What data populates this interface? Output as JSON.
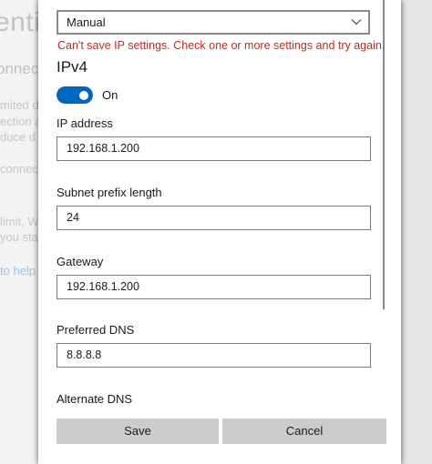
{
  "background": {
    "heading": "entit",
    "subheading": "onnect",
    "lines": [
      "mited da",
      "ection a",
      "duce d",
      "connect",
      "limit, W",
      "you stay"
    ],
    "link": "to help"
  },
  "dialog": {
    "assignment_select": {
      "value": "Manual"
    },
    "error_message": "Can't save IP settings. Check one or more settings and try again.",
    "section_title": "IPv4",
    "toggle": {
      "state": "on",
      "label": "On"
    },
    "fields": [
      {
        "label": "IP address",
        "value": "192.168.1.200"
      },
      {
        "label": "Subnet prefix length",
        "value": "24"
      },
      {
        "label": "Gateway",
        "value": "192.168.1.200"
      },
      {
        "label": "Preferred DNS",
        "value": "8.8.8.8"
      },
      {
        "label": "Alternate DNS",
        "value": ""
      }
    ],
    "buttons": {
      "save": "Save",
      "cancel": "Cancel"
    }
  },
  "colors": {
    "accent": "#0067c0",
    "error": "#c42b1c",
    "button": "#cccccc"
  },
  "icons": {
    "select": "chevron-down-icon"
  }
}
